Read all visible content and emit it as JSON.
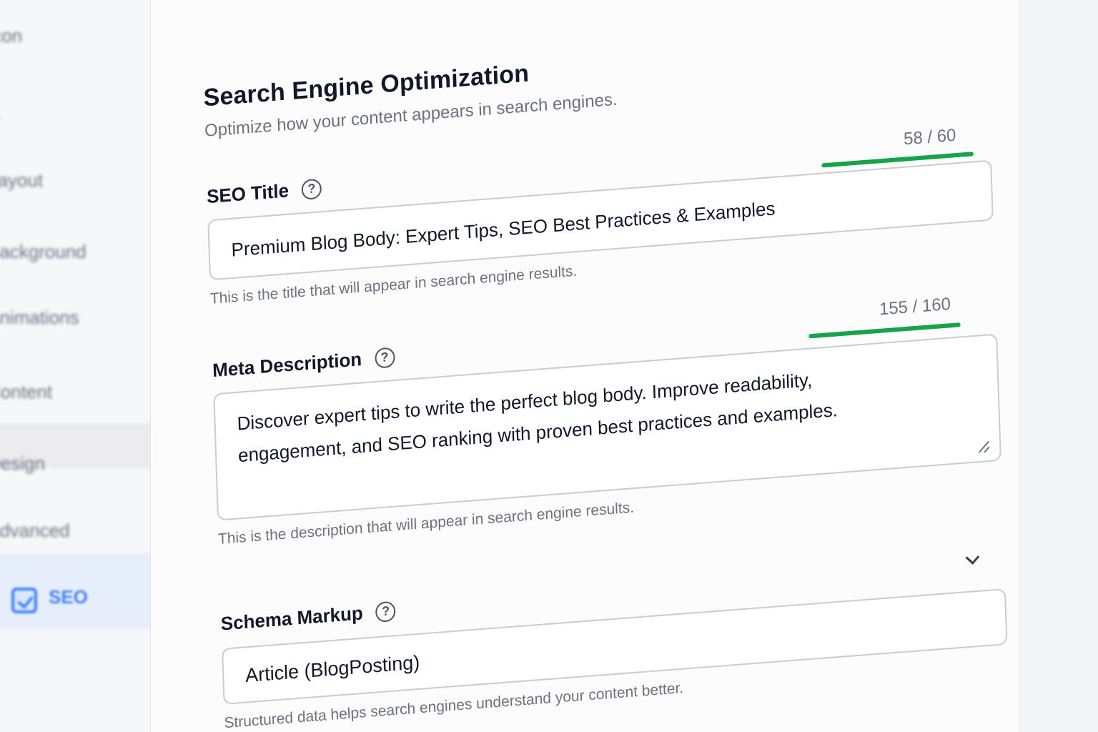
{
  "sidebar": {
    "items": [
      {
        "label": "Icon"
      },
      {
        "label": "A"
      },
      {
        "label": "Layout"
      },
      {
        "label": "Background"
      },
      {
        "label": "Animations"
      },
      {
        "label": "Content"
      },
      {
        "label": "Design"
      },
      {
        "label": "Advanced"
      }
    ],
    "active": {
      "label": "SEO",
      "icon": "check-square-icon"
    }
  },
  "page": {
    "title": "Search Engine Optimization",
    "subtitle": "Optimize how your content appears in search engines."
  },
  "seo_title": {
    "label": "SEO Title",
    "help_icon": "?",
    "counter": "58 / 60",
    "count": 58,
    "max": 60,
    "value": "Premium Blog Body: Expert Tips, SEO Best Practices & Examples",
    "hint": "This is the title that will appear in search engine results."
  },
  "meta_description": {
    "label": "Meta Description",
    "help_icon": "?",
    "counter": "155 / 160",
    "count": 155,
    "max": 160,
    "value": "Discover expert tips to write the perfect blog body. Improve readability, engagement, and SEO ranking with proven best practices and examples.",
    "hint": "This is the description that will appear in search engine results."
  },
  "schema_markup": {
    "label": "Schema Markup",
    "help_icon": "?",
    "selected": "Article (BlogPosting)",
    "hint": "Structured data helps search engines understand your content better.",
    "chevron_icon": "chevron-down-icon"
  },
  "colors": {
    "accent": "#3b82f6",
    "counter_ok": "#16a34a",
    "text": "#111827",
    "muted": "#6b7280"
  }
}
